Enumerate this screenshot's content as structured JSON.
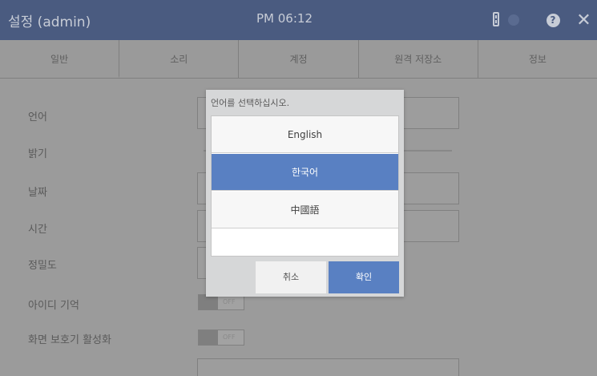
{
  "header": {
    "title": "설정 (admin)",
    "time": "PM 06:12",
    "help_glyph": "?",
    "close_glyph": "✕",
    "icons": [
      "battery-icon",
      "status-dot-icon",
      "help-icon",
      "close-icon"
    ]
  },
  "tabs": [
    {
      "label": "일반",
      "active": true
    },
    {
      "label": "소리"
    },
    {
      "label": "계정"
    },
    {
      "label": "원격 저장소"
    },
    {
      "label": "정보"
    }
  ],
  "settings": {
    "language": "언어",
    "brightness": "밝기",
    "date": "날짜",
    "time": "시간",
    "precision": "정밀도",
    "remember_id": "아이디 기억",
    "remember_id_state": "OFF",
    "screensaver": "화면 보호기 활성화",
    "screensaver_state": "OFF"
  },
  "dialog": {
    "title": "언어를 선택하십시오.",
    "options": [
      {
        "label": "English"
      },
      {
        "label": "한국어",
        "selected": true
      },
      {
        "label": "中國語"
      }
    ],
    "cancel_label": "취소",
    "ok_label": "확인"
  },
  "colors": {
    "header": "#4a5b80",
    "accent": "#5980c2",
    "overlay": "#9b9b9b"
  }
}
